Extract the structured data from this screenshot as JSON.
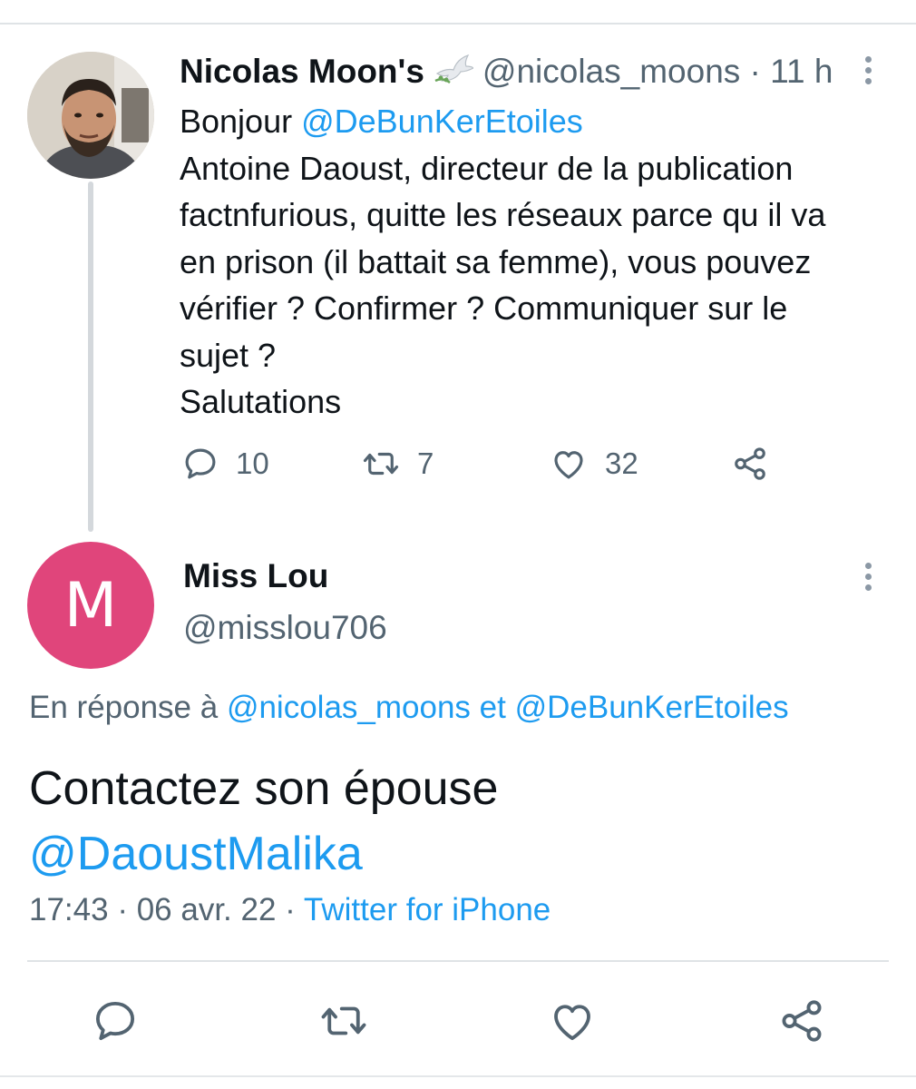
{
  "parent_tweet": {
    "author_name": "Nicolas Moon's",
    "author_handle": "@nicolas_moons",
    "time_ago": "11 h",
    "lines": [
      {
        "prefix": "Bonjour ",
        "mention": "@DeBunKerEtoiles"
      },
      {
        "text": "Antoine Daoust, directeur de la publication"
      },
      {
        "text": "factnfurious, quitte les réseaux parce qu il va"
      },
      {
        "text": "en prison (il battait sa femme), vous pouvez"
      },
      {
        "text": "vérifier ? Confirmer ? Communiquer sur le"
      },
      {
        "text": "sujet ?"
      },
      {
        "text": "Salutations"
      }
    ],
    "replies_count": "10",
    "retweets_count": "7",
    "likes_count": "32"
  },
  "reply_tweet": {
    "avatar_letter": "M",
    "avatar_color": "#e0457b",
    "author_name": "Miss Lou",
    "author_handle": "@misslou706",
    "replying_prefix": "En réponse à ",
    "replying_mention_1": "@nicolas_moons",
    "replying_and": " et ",
    "replying_mention_2": "@DeBunKerEtoiles",
    "text_line_1": "Contactez son épouse",
    "text_mention": "@DaoustMalika",
    "time": "17:43",
    "date": "06 avr. 22",
    "source": "Twitter for iPhone"
  },
  "colors": {
    "link": "#1d9bf0",
    "secondary_text": "#536471",
    "primary_text": "#0f1419"
  },
  "icons": [
    "reply-icon",
    "retweet-icon",
    "like-icon",
    "share-icon",
    "more-icon",
    "dove-icon"
  ]
}
